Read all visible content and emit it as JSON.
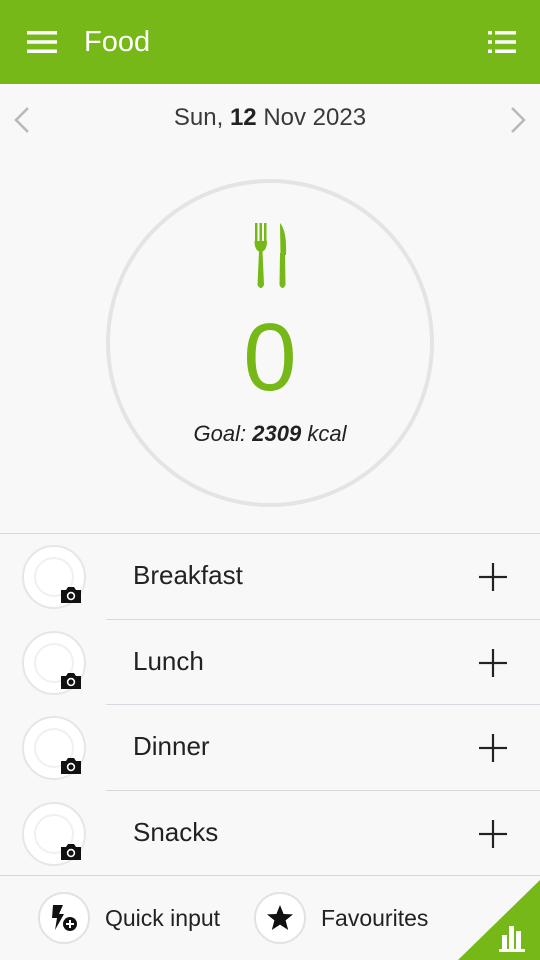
{
  "app_bar": {
    "title": "Food",
    "menu_icon": "hamburger-menu-icon",
    "list_icon": "list-view-icon",
    "background": "#75b817"
  },
  "date_nav": {
    "weekday": "Sun,",
    "day": "12",
    "month_year": "Nov 2023"
  },
  "summary": {
    "icon": "fork-knife-icon",
    "consumed": "0",
    "goal_prefix": "Goal:",
    "goal_value": "2309",
    "goal_unit": "kcal",
    "accent": "#75b817"
  },
  "meals": [
    {
      "label": "Breakfast"
    },
    {
      "label": "Lunch"
    },
    {
      "label": "Dinner"
    },
    {
      "label": "Snacks"
    }
  ],
  "bottom": {
    "quick_input": "Quick input",
    "favourites": "Favourites",
    "chart_icon": "bar-chart-icon"
  }
}
